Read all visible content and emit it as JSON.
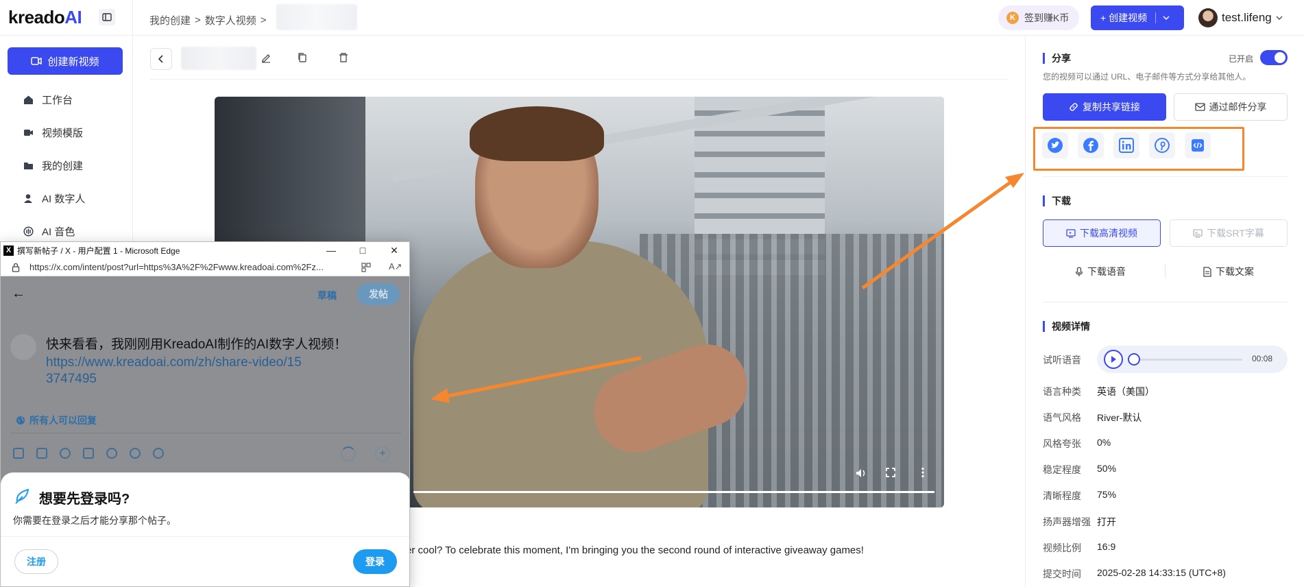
{
  "header": {
    "logo_text": "kreado",
    "logo_ai": "AI",
    "breadcrumb": [
      "我的创建",
      ">",
      "数字人视频",
      ">"
    ],
    "signin_label": "签到赚K币",
    "create_video_label": "+ 创建视频",
    "username": "test.lifeng"
  },
  "sidebar": {
    "new_video_label": "创建新视频",
    "items": [
      {
        "label": "工作台",
        "icon": "home-icon"
      },
      {
        "label": "视频模版",
        "icon": "video-template-icon"
      },
      {
        "label": "我的创建",
        "icon": "folder-icon"
      },
      {
        "label": "AI 数字人",
        "icon": "user-icon"
      },
      {
        "label": "AI 音色",
        "icon": "voice-icon"
      }
    ]
  },
  "main": {
    "description": "er cool? To celebrate this moment, I'm bringing you the second round of interactive giveaway games!"
  },
  "share": {
    "title": "分享",
    "toggle_label": "已开启",
    "subtitle": "您的视频可以通过 URL、电子邮件等方式分享给其他人。",
    "copy_link_label": "复制共享链接",
    "email_label": "通过邮件分享",
    "socials": [
      "twitter-icon",
      "facebook-icon",
      "linkedin-icon",
      "pinterest-icon",
      "embed-code-icon"
    ]
  },
  "download": {
    "title": "下载",
    "hd_label": "下载高清视频",
    "srt_label": "下载SRT字幕",
    "audio_label": "下载语音",
    "text_label": "下载文案"
  },
  "details": {
    "title": "视频详情",
    "preview_label": "试听语音",
    "audio_time": "00:08",
    "rows": [
      {
        "label": "语言种类",
        "value": "英语（美国）"
      },
      {
        "label": "语气风格",
        "value": "River-默认"
      },
      {
        "label": "风格夸张",
        "value": "0%"
      },
      {
        "label": "稳定程度",
        "value": "50%"
      },
      {
        "label": "清晰程度",
        "value": "75%"
      },
      {
        "label": "扬声器增强",
        "value": "打开"
      },
      {
        "label": "视频比例",
        "value": "16:9"
      },
      {
        "label": "提交时间",
        "value": "2025-02-28 14:33:15 (UTC+8)"
      }
    ]
  },
  "edge": {
    "window_title": "撰写新帖子 / X - 用户配置 1 - Microsoft Edge",
    "url": "https://x.com/intent/post?url=https%3A%2F%2Fwww.kreadoai.com%2Fz...",
    "draft_label": "草稿",
    "post_label": "发帖",
    "post_text": "快来看看，我刚刚用KreadoAI制作的AI数字人视频！",
    "post_link": "https://www.kreadoai.com/zh/share-video/153747495",
    "reply_label": "所有人可以回复",
    "login_title": "想要先登录吗?",
    "login_sub": "你需要在登录之后才能分享那个帖子。",
    "signup_label": "注册",
    "login_label": "登录"
  },
  "colors": {
    "accent": "#3b49f0",
    "annotation": "#f5872f",
    "x_blue": "#1d9bf0"
  }
}
